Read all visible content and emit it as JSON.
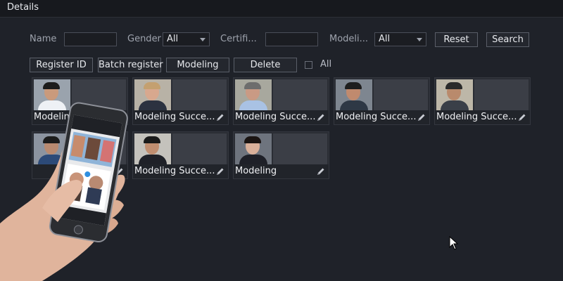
{
  "window": {
    "title": "Details"
  },
  "filters": {
    "name_label": "Name",
    "name_value": "",
    "gender_label": "Gender",
    "gender_value": "All",
    "certificate_label": "Certifi...",
    "certificate_value": "",
    "modeling_label": "Modeli...",
    "modeling_value": "All",
    "reset_label": "Reset",
    "search_label": "Search"
  },
  "toolbar": {
    "register_id_label": "Register ID",
    "batch_register_label": "Batch register",
    "modeling_label": "Modeling",
    "delete_label": "Delete",
    "select_all_label": "All"
  },
  "cards": [
    {
      "status": "Modeling S"
    },
    {
      "status": "Modeling Succe..."
    },
    {
      "status": "Modeling Succe..."
    },
    {
      "status": "Modeling Succe..."
    },
    {
      "status": "Modeling Succe..."
    },
    {
      "status": ""
    },
    {
      "status": "Modeling Succe..."
    },
    {
      "status": "Modeling"
    }
  ],
  "icons": {
    "edit": "pencil-icon",
    "cursor": "mouse-pointer-icon"
  },
  "colors": {
    "background": "#1f2229",
    "card": "#2a2d34",
    "text": "#f0f1f4"
  }
}
